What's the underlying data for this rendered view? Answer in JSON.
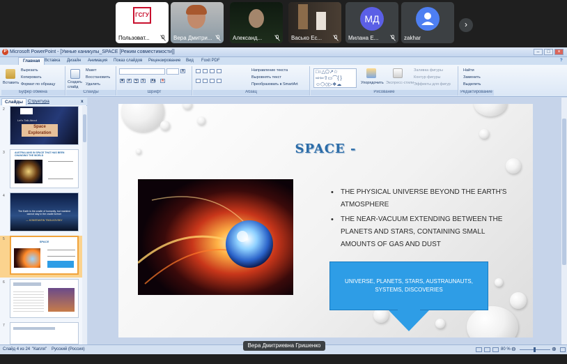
{
  "conference": {
    "participants": [
      {
        "name": "Пользоват...",
        "kind": "logo",
        "logo_text": "ГСГУ"
      },
      {
        "name": "Вера Дмитри...",
        "kind": "video"
      },
      {
        "name": "Александ...",
        "kind": "video"
      },
      {
        "name": "Васько Ес...",
        "kind": "video"
      },
      {
        "name": "Милана Е...",
        "kind": "avatar",
        "initials": "МД",
        "color": "#5b5fe6"
      },
      {
        "name": "zakhar",
        "kind": "avatar",
        "initials": "",
        "color": "#4e7ff2"
      }
    ],
    "next_icon": "chevron-right-icon",
    "speaker": "Вера Дмитриевна Гришенко"
  },
  "window": {
    "title": "Microsoft PowerPoint - [Умные каникулы_SPACE [Режим совместимости]]"
  },
  "ribbon": {
    "tabs": [
      "Главная",
      "Вставка",
      "Дизайн",
      "Анимация",
      "Показ слайдов",
      "Рецензирование",
      "Вид",
      "Foxit PDF"
    ],
    "active_tab": "Главная",
    "clipboard": {
      "label": "Буфер обмена",
      "paste": "Вставить",
      "cut": "Вырезать",
      "copy": "Копировать",
      "format": "Формат по образцу"
    },
    "slides": {
      "label": "Слайды",
      "create": "Создать слайд",
      "layout": "Макет",
      "reset": "Восстановить",
      "delete": "Удалить"
    },
    "font": {
      "label": "Шрифт"
    },
    "paragraph": {
      "label": "Абзац",
      "direction": "Направление текста",
      "align": "Выровнять текст",
      "smartart": "Преобразовать в SmartArt"
    },
    "drawing": {
      "label": "Рисование",
      "arrange": "Упорядочить",
      "quick_styles": "Экспресс-стили",
      "fill": "Заливка фигуры",
      "outline": "Контур фигуры",
      "effects": "Эффекты для фигур"
    },
    "editing": {
      "label": "Редактирование",
      "find": "Найти",
      "replace": "Заменить",
      "select": "Выделить"
    }
  },
  "panel": {
    "tab_slides": "Слайды",
    "tab_outline": "Структура",
    "close": "x",
    "thumbnails": [
      {
        "num": "2",
        "title": "Space Exploration",
        "sub": "Let's Talk About"
      },
      {
        "num": "3",
        "title": "AUSTRALIANS IN SPACE THAT HAS BEEN CHANGING THE WORLD",
        "sub": ""
      },
      {
        "num": "4",
        "title": "The Earth is the cradle of humanity, but mankind cannot stay in the cradle forever",
        "sub": "— KONSTANTIN TSIOLKOVSKY"
      },
      {
        "num": "5",
        "title": "SPACE",
        "sub": ""
      },
      {
        "num": "6",
        "title": "",
        "sub": ""
      },
      {
        "num": "7",
        "title": "",
        "sub": ""
      }
    ],
    "selected_index": 3
  },
  "slide": {
    "title": "SPACE -",
    "bullets": [
      "The physical universe beyond the Earth's atmosphere",
      "The near-vacuum extending between the planets and stars, containing small amounts of gas and dust"
    ],
    "callout": "Universe, planets, stars, austraunauts, systems, discoveries"
  },
  "statusbar": {
    "slide_info": "Слайд 4 из 24",
    "theme": "\"Капля\"",
    "language": "Русский (Россия)",
    "zoom": "80 %"
  },
  "colors": {
    "accent_blue": "#2e9de6",
    "title_blue": "#2b6ca8",
    "ribbon_bg": "#dbe7f6",
    "selected_thumb": "#f0a33c"
  }
}
